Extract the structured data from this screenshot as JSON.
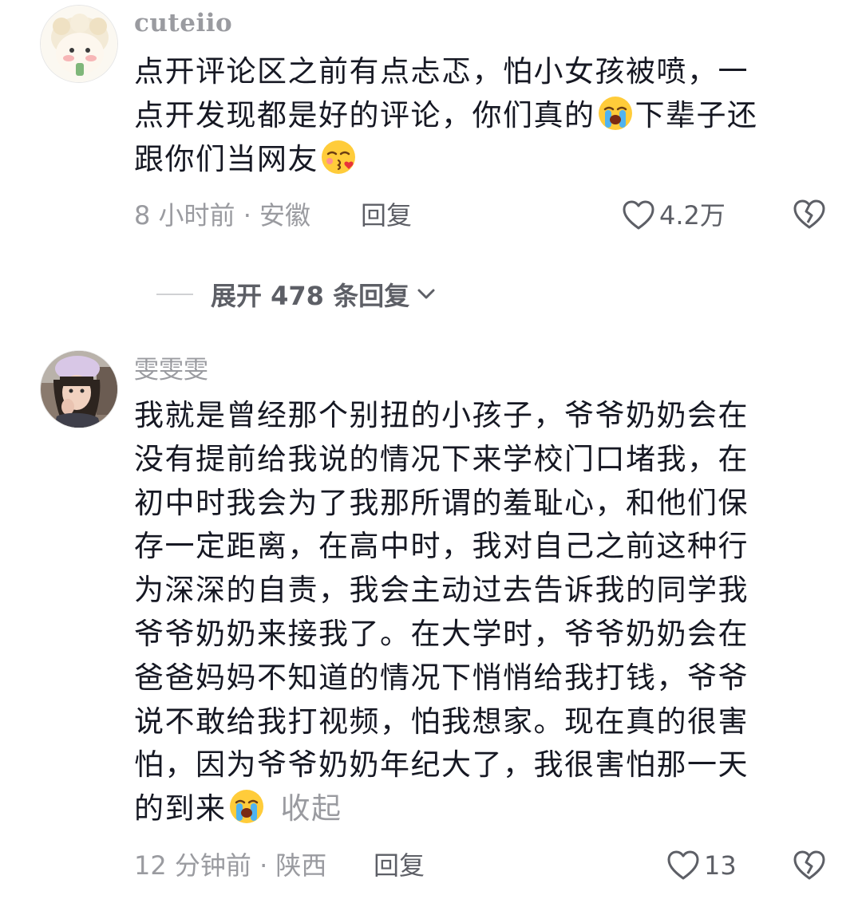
{
  "comments": [
    {
      "username": "cuteiio",
      "avatar": "sheep-avatar",
      "lines": [
        [
          {
            "t": "点开评论区之前有点忐忑，怕小女孩被喷，一"
          }
        ],
        [
          {
            "t": "点开发现都是好的评论，你们真的"
          },
          {
            "emoji": "loudly-crying-face-emoji"
          },
          {
            "t": "下辈子还"
          }
        ],
        [
          {
            "t": "跟你们当网友"
          },
          {
            "emoji": "face-blowing-kiss-emoji"
          }
        ]
      ],
      "time_location": "8 小时前 · 安徽",
      "reply_label": "回复",
      "like_count": "4.2万"
    },
    {
      "username": "雯雯雯",
      "avatar": "girl-photo-avatar",
      "lines": [
        [
          {
            "t": "我就是曾经那个别扭的小孩子，爷爷奶奶会在"
          }
        ],
        [
          {
            "t": "没有提前给我说的情况下来学校门口堵我，在"
          }
        ],
        [
          {
            "t": "初中时我会为了我那所谓的羞耻心，和他们保"
          }
        ],
        [
          {
            "t": "存一定距离，在高中时，我对自己之前这种行"
          }
        ],
        [
          {
            "t": "为深深的自责，我会主动过去告诉我的同学我"
          }
        ],
        [
          {
            "t": "爷爷奶奶来接我了。在大学时，爷爷奶奶会在"
          }
        ],
        [
          {
            "t": "爸爸妈妈不知道的情况下悄悄给我打钱，爷爷"
          }
        ],
        [
          {
            "t": "说不敢给我打视频，怕我想家。现在真的很害"
          }
        ],
        [
          {
            "t": "怕，因为爷爷奶奶年纪大了，我很害怕那一天"
          }
        ],
        [
          {
            "t": "的到来"
          },
          {
            "emoji": "loudly-crying-face-emoji"
          }
        ]
      ],
      "collapse_label": "收起",
      "time_location": "12 分钟前 · 陕西",
      "reply_label": "回复",
      "like_count": "13"
    }
  ],
  "expand_replies": {
    "label": "展开 478 条回复",
    "icon": "chevron-down-icon"
  }
}
